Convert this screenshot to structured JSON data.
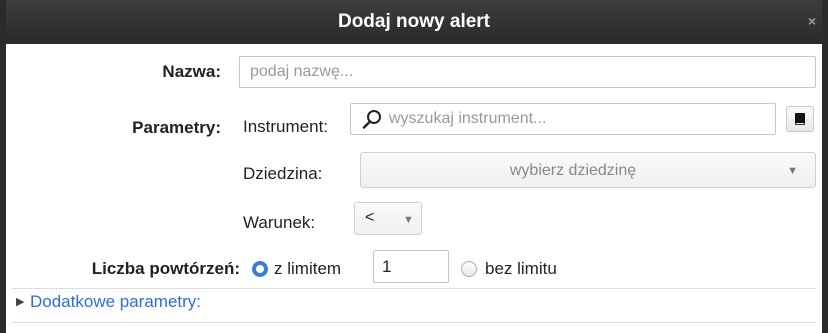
{
  "dialog": {
    "title": "Dodaj nowy alert",
    "close_glyph": "×"
  },
  "name": {
    "label": "Nazwa:",
    "placeholder": "podaj nazwę..."
  },
  "parameters": {
    "label": "Parametry:",
    "instrument_label": "Instrument:",
    "instrument_placeholder": "wyszukaj instrument...",
    "domain_label": "Dziedzina:",
    "domain_value": "wybierz dziedzinę",
    "condition_label": "Warunek:",
    "condition_value": "<"
  },
  "repetitions": {
    "label": "Liczba powtórzeń:",
    "option_limit": "z limitem",
    "limit_value": "1",
    "option_no_limit": "bez limitu",
    "selected": "z limitem"
  },
  "additional": {
    "label": "Dodatkowe parametry:"
  },
  "icons": {
    "close": "close-icon",
    "search": "search-icon",
    "book": "book-icon",
    "dropdown": "chevron-down-icon",
    "expand": "triangle-right-icon"
  },
  "colors": {
    "title_bg": "#2f2f2f",
    "accent": "#3b7ed0",
    "link": "#2b6fd6"
  }
}
